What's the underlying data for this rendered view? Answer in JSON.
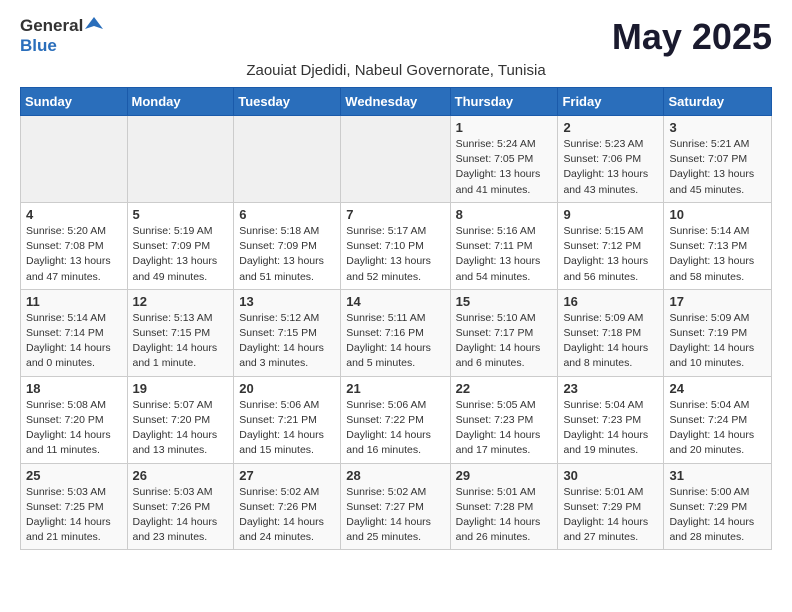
{
  "header": {
    "logo_general": "General",
    "logo_blue": "Blue",
    "month_title": "May 2025",
    "subtitle": "Zaouiat Djedidi, Nabeul Governorate, Tunisia"
  },
  "weekdays": [
    "Sunday",
    "Monday",
    "Tuesday",
    "Wednesday",
    "Thursday",
    "Friday",
    "Saturday"
  ],
  "weeks": [
    [
      {
        "day": "",
        "info": ""
      },
      {
        "day": "",
        "info": ""
      },
      {
        "day": "",
        "info": ""
      },
      {
        "day": "",
        "info": ""
      },
      {
        "day": "1",
        "info": "Sunrise: 5:24 AM\nSunset: 7:05 PM\nDaylight: 13 hours\nand 41 minutes."
      },
      {
        "day": "2",
        "info": "Sunrise: 5:23 AM\nSunset: 7:06 PM\nDaylight: 13 hours\nand 43 minutes."
      },
      {
        "day": "3",
        "info": "Sunrise: 5:21 AM\nSunset: 7:07 PM\nDaylight: 13 hours\nand 45 minutes."
      }
    ],
    [
      {
        "day": "4",
        "info": "Sunrise: 5:20 AM\nSunset: 7:08 PM\nDaylight: 13 hours\nand 47 minutes."
      },
      {
        "day": "5",
        "info": "Sunrise: 5:19 AM\nSunset: 7:09 PM\nDaylight: 13 hours\nand 49 minutes."
      },
      {
        "day": "6",
        "info": "Sunrise: 5:18 AM\nSunset: 7:09 PM\nDaylight: 13 hours\nand 51 minutes."
      },
      {
        "day": "7",
        "info": "Sunrise: 5:17 AM\nSunset: 7:10 PM\nDaylight: 13 hours\nand 52 minutes."
      },
      {
        "day": "8",
        "info": "Sunrise: 5:16 AM\nSunset: 7:11 PM\nDaylight: 13 hours\nand 54 minutes."
      },
      {
        "day": "9",
        "info": "Sunrise: 5:15 AM\nSunset: 7:12 PM\nDaylight: 13 hours\nand 56 minutes."
      },
      {
        "day": "10",
        "info": "Sunrise: 5:14 AM\nSunset: 7:13 PM\nDaylight: 13 hours\nand 58 minutes."
      }
    ],
    [
      {
        "day": "11",
        "info": "Sunrise: 5:14 AM\nSunset: 7:14 PM\nDaylight: 14 hours\nand 0 minutes."
      },
      {
        "day": "12",
        "info": "Sunrise: 5:13 AM\nSunset: 7:15 PM\nDaylight: 14 hours\nand 1 minute."
      },
      {
        "day": "13",
        "info": "Sunrise: 5:12 AM\nSunset: 7:15 PM\nDaylight: 14 hours\nand 3 minutes."
      },
      {
        "day": "14",
        "info": "Sunrise: 5:11 AM\nSunset: 7:16 PM\nDaylight: 14 hours\nand 5 minutes."
      },
      {
        "day": "15",
        "info": "Sunrise: 5:10 AM\nSunset: 7:17 PM\nDaylight: 14 hours\nand 6 minutes."
      },
      {
        "day": "16",
        "info": "Sunrise: 5:09 AM\nSunset: 7:18 PM\nDaylight: 14 hours\nand 8 minutes."
      },
      {
        "day": "17",
        "info": "Sunrise: 5:09 AM\nSunset: 7:19 PM\nDaylight: 14 hours\nand 10 minutes."
      }
    ],
    [
      {
        "day": "18",
        "info": "Sunrise: 5:08 AM\nSunset: 7:20 PM\nDaylight: 14 hours\nand 11 minutes."
      },
      {
        "day": "19",
        "info": "Sunrise: 5:07 AM\nSunset: 7:20 PM\nDaylight: 14 hours\nand 13 minutes."
      },
      {
        "day": "20",
        "info": "Sunrise: 5:06 AM\nSunset: 7:21 PM\nDaylight: 14 hours\nand 15 minutes."
      },
      {
        "day": "21",
        "info": "Sunrise: 5:06 AM\nSunset: 7:22 PM\nDaylight: 14 hours\nand 16 minutes."
      },
      {
        "day": "22",
        "info": "Sunrise: 5:05 AM\nSunset: 7:23 PM\nDaylight: 14 hours\nand 17 minutes."
      },
      {
        "day": "23",
        "info": "Sunrise: 5:04 AM\nSunset: 7:23 PM\nDaylight: 14 hours\nand 19 minutes."
      },
      {
        "day": "24",
        "info": "Sunrise: 5:04 AM\nSunset: 7:24 PM\nDaylight: 14 hours\nand 20 minutes."
      }
    ],
    [
      {
        "day": "25",
        "info": "Sunrise: 5:03 AM\nSunset: 7:25 PM\nDaylight: 14 hours\nand 21 minutes."
      },
      {
        "day": "26",
        "info": "Sunrise: 5:03 AM\nSunset: 7:26 PM\nDaylight: 14 hours\nand 23 minutes."
      },
      {
        "day": "27",
        "info": "Sunrise: 5:02 AM\nSunset: 7:26 PM\nDaylight: 14 hours\nand 24 minutes."
      },
      {
        "day": "28",
        "info": "Sunrise: 5:02 AM\nSunset: 7:27 PM\nDaylight: 14 hours\nand 25 minutes."
      },
      {
        "day": "29",
        "info": "Sunrise: 5:01 AM\nSunset: 7:28 PM\nDaylight: 14 hours\nand 26 minutes."
      },
      {
        "day": "30",
        "info": "Sunrise: 5:01 AM\nSunset: 7:29 PM\nDaylight: 14 hours\nand 27 minutes."
      },
      {
        "day": "31",
        "info": "Sunrise: 5:00 AM\nSunset: 7:29 PM\nDaylight: 14 hours\nand 28 minutes."
      }
    ]
  ]
}
